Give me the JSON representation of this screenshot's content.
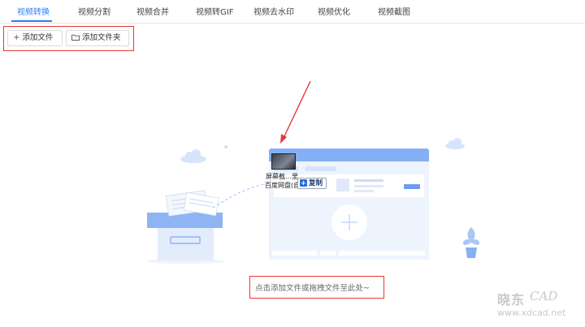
{
  "tabs": [
    {
      "label": "视频转换",
      "active": true
    },
    {
      "label": "视频分割"
    },
    {
      "label": "视频合并"
    },
    {
      "label": "视频转GIF"
    },
    {
      "label": "视频去水印"
    },
    {
      "label": "视频优化"
    },
    {
      "label": "视频截图"
    }
  ],
  "toolbar": {
    "add_file_label": "添加文件",
    "add_folder_label": "添加文件夹"
  },
  "drag_overlay": {
    "line1": "屏幕截…里",
    "line2": "百度网盘(自",
    "copy_label": "复制"
  },
  "drop_hint": "点击添加文件或拖拽文件至此处~",
  "watermark": {
    "cn": "晓东",
    "cad": "CAD",
    "url": "www.xdcad.net"
  },
  "colors": {
    "accent": "#2f7cf6",
    "highlight_border": "#e53935",
    "illustration_blue": "#86b0f5",
    "illustration_light": "#e8f0fd"
  },
  "icons": {
    "add_file": "plus-icon",
    "add_folder": "folder-icon",
    "copy": "plus-square-icon"
  }
}
